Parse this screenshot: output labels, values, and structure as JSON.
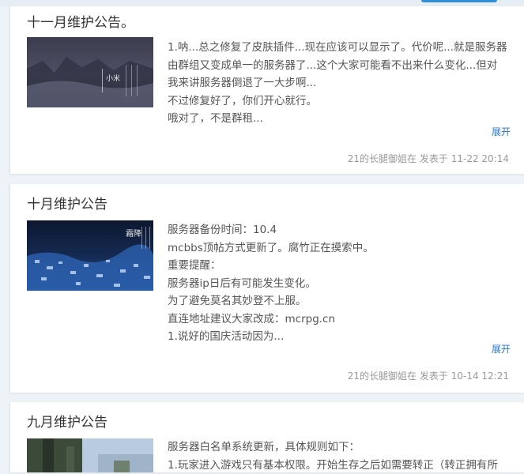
{
  "posts": [
    {
      "title": "十一月维护公告。",
      "lines": [
        "1.呐...总之修复了皮肤插件...现在应该可以显示了。代价呢...就是服务器",
        "由群组又变成单一的服务器了...这个大家可能看不出来什么变化...但对",
        "我来讲服务器倒退了一大步啊...",
        "不过修复好了，你们开心就行。",
        "哦对了，不是群租..."
      ],
      "expand_label": "展开",
      "author": "21的长腿御姐在",
      "posted_label": "发表于",
      "date": "11-22 20:14",
      "thumb_text": "小米"
    },
    {
      "title": "十月维护公告",
      "lines": [
        "服务器备份时间：10.4",
        "mcbbs顶帖方式更新了。腐竹正在摸索中。",
        "重要提醒：",
        "服务器ip日后有可能发生变化。",
        "为了避免莫名其妙登不上服。",
        "直连地址建议大家改成：mcrpg.cn",
        "1.说好的国庆活动因为..."
      ],
      "expand_label": "展开",
      "author": "21的长腿御姐在",
      "posted_label": "发表于",
      "date": "10-14 12:21",
      "thumb_text": "霜降"
    },
    {
      "title": "九月维护公告",
      "lines": [
        "服务器白名单系统更新，具体规则如下：",
        "1.玩家进入游戏只有基本权限。开始生存之后如需要转正（转正拥有所"
      ]
    }
  ],
  "colors": {
    "accent": "#2878c6",
    "page_bg": "#eef3f8"
  }
}
